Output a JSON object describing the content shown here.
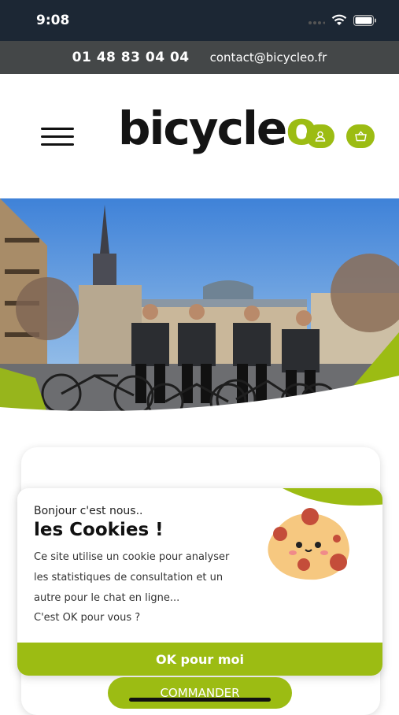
{
  "status_bar": {
    "time": "9:08"
  },
  "contact": {
    "phone": "01 48 83 04 04",
    "email": "contact@bicycleo.fr"
  },
  "header": {
    "logo_text": "bicycle",
    "logo_accent": "o"
  },
  "cookie_banner": {
    "intro": "Bonjour c'est nous..",
    "title": "les Cookies !",
    "line1": "Ce site utilise un cookie pour analyser",
    "line2": "les statistiques de consultation et un",
    "line3": "autre pour le chat en ligne...",
    "line4": "C'est OK pour vous ?",
    "ok_label": "OK pour moi"
  },
  "cta": {
    "label": "COMMANDER"
  },
  "colors": {
    "accent": "#9cbc13",
    "status_bg": "#1c2734",
    "contact_bg": "#444748"
  },
  "icons": [
    "wifi-icon",
    "signal-icon",
    "battery-icon",
    "menu-icon",
    "user-icon",
    "basket-icon",
    "cookie-icon"
  ]
}
